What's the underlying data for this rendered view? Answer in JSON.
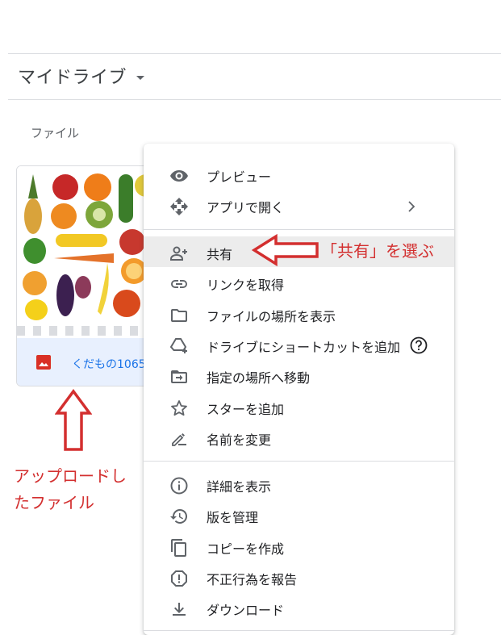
{
  "header": {
    "title": "マイドライブ"
  },
  "section": {
    "files_label": "ファイル"
  },
  "file_card": {
    "name": "くだもの1065"
  },
  "menu": {
    "items": [
      {
        "label": "プレビュー",
        "icon": "eye-icon"
      },
      {
        "label": "アプリで開く",
        "icon": "open-with-icon"
      },
      {
        "label": "共有",
        "icon": "person-add-icon"
      },
      {
        "label": "リンクを取得",
        "icon": "link-icon"
      },
      {
        "label": "ファイルの場所を表示",
        "icon": "folder-icon"
      },
      {
        "label": "ドライブにショートカットを追加",
        "icon": "drive-shortcut-icon"
      },
      {
        "label": "指定の場所へ移動",
        "icon": "move-to-folder-icon"
      },
      {
        "label": "スターを追加",
        "icon": "star-icon"
      },
      {
        "label": "名前を変更",
        "icon": "rename-icon"
      },
      {
        "label": "詳細を表示",
        "icon": "info-icon"
      },
      {
        "label": "版を管理",
        "icon": "history-icon"
      },
      {
        "label": "コピーを作成",
        "icon": "copy-icon"
      },
      {
        "label": "不正行為を報告",
        "icon": "report-icon"
      },
      {
        "label": "ダウンロード",
        "icon": "download-icon"
      }
    ]
  },
  "annotations": {
    "share_hint": "「共有」を選ぶ",
    "uploaded_file_hint": "アップロードしたファイル"
  },
  "colors": {
    "annotation_red": "#d32f2f",
    "file_link_blue": "#1a73e8",
    "highlight": "#ececec"
  }
}
